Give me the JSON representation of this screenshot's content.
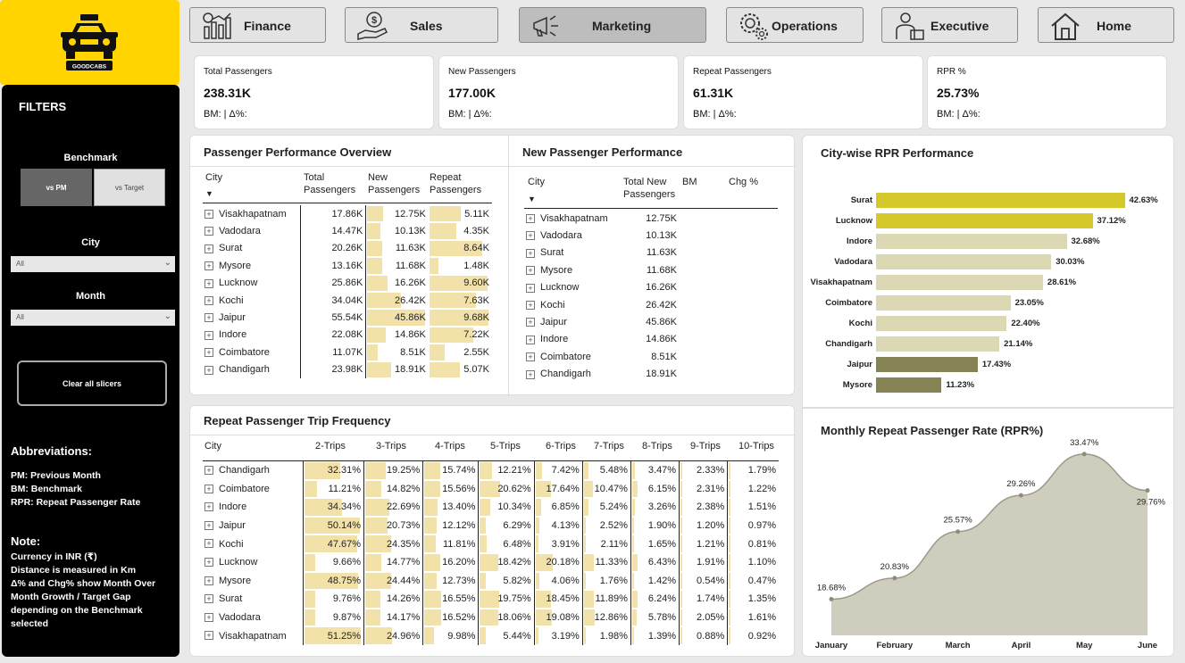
{
  "logo": {
    "text": "GOODCABS"
  },
  "sidebar": {
    "title": "FILTERS",
    "benchmark_label": "Benchmark",
    "bench_options": [
      "vs PM",
      "vs Target"
    ],
    "city_label": "City",
    "city_value": "All",
    "month_label": "Month",
    "month_value": "All",
    "clear_label": "Clear all slicers",
    "abbr_title": "Abbreviations:",
    "abbr": [
      "PM: Previous Month",
      "BM: Benchmark",
      "RPR: Repeat Passenger Rate"
    ],
    "note_title": "Note:",
    "note_lines": [
      "Currency in INR (₹)",
      "Distance is measured in Km",
      "Δ% and Chg% show Month Over",
      "Month Growth / Target Gap",
      "depending on the Benchmark",
      "selected"
    ]
  },
  "nav": [
    {
      "label": "Finance",
      "icon": "finance-chart-icon"
    },
    {
      "label": "Sales",
      "icon": "sales-hand-coin-icon"
    },
    {
      "label": "Marketing",
      "icon": "megaphone-icon"
    },
    {
      "label": "Operations",
      "icon": "gears-icon"
    },
    {
      "label": "Executive",
      "icon": "executive-person-icon"
    },
    {
      "label": "Home",
      "icon": "home-icon"
    }
  ],
  "kpis": [
    {
      "title": "Total Passengers",
      "value": "238.31K",
      "sub": "BM: | Δ%:"
    },
    {
      "title": "New Passengers",
      "value": "177.00K",
      "sub": "BM: | Δ%:"
    },
    {
      "title": "Repeat Passengers",
      "value": "61.31K",
      "sub": "BM: | Δ%:"
    },
    {
      "title": "RPR %",
      "value": "25.73%",
      "sub": "BM: | Δ%:"
    }
  ],
  "overview": {
    "title": "Passenger Performance Overview",
    "headers": [
      "City",
      "Total Passengers",
      "New Passengers",
      "Repeat Passengers"
    ],
    "rows": [
      {
        "city": "Visakhapatnam",
        "total": "17.86K",
        "new": "12.75K",
        "repeat": "5.11K",
        "new_v": 12.75,
        "rep_v": 5.11
      },
      {
        "city": "Vadodara",
        "total": "14.47K",
        "new": "10.13K",
        "repeat": "4.35K",
        "new_v": 10.13,
        "rep_v": 4.35
      },
      {
        "city": "Surat",
        "total": "20.26K",
        "new": "11.63K",
        "repeat": "8.64K",
        "new_v": 11.63,
        "rep_v": 8.64
      },
      {
        "city": "Mysore",
        "total": "13.16K",
        "new": "11.68K",
        "repeat": "1.48K",
        "new_v": 11.68,
        "rep_v": 1.48
      },
      {
        "city": "Lucknow",
        "total": "25.86K",
        "new": "16.26K",
        "repeat": "9.60K",
        "new_v": 16.26,
        "rep_v": 9.6
      },
      {
        "city": "Kochi",
        "total": "34.04K",
        "new": "26.42K",
        "repeat": "7.63K",
        "new_v": 26.42,
        "rep_v": 7.63
      },
      {
        "city": "Jaipur",
        "total": "55.54K",
        "new": "45.86K",
        "repeat": "9.68K",
        "new_v": 45.86,
        "rep_v": 9.68
      },
      {
        "city": "Indore",
        "total": "22.08K",
        "new": "14.86K",
        "repeat": "7.22K",
        "new_v": 14.86,
        "rep_v": 7.22
      },
      {
        "city": "Coimbatore",
        "total": "11.07K",
        "new": "8.51K",
        "repeat": "2.55K",
        "new_v": 8.51,
        "rep_v": 2.55
      },
      {
        "city": "Chandigarh",
        "total": "23.98K",
        "new": "18.91K",
        "repeat": "5.07K",
        "new_v": 18.91,
        "rep_v": 5.07
      }
    ]
  },
  "newperf": {
    "title": "New Passenger Performance",
    "headers": [
      "City",
      "Total New Passengers",
      "BM",
      "Chg %"
    ],
    "rows": [
      {
        "city": "Visakhapatnam",
        "total": "12.75K"
      },
      {
        "city": "Vadodara",
        "total": "10.13K"
      },
      {
        "city": "Surat",
        "total": "11.63K"
      },
      {
        "city": "Mysore",
        "total": "11.68K"
      },
      {
        "city": "Lucknow",
        "total": "16.26K"
      },
      {
        "city": "Kochi",
        "total": "26.42K"
      },
      {
        "city": "Jaipur",
        "total": "45.86K"
      },
      {
        "city": "Indore",
        "total": "14.86K"
      },
      {
        "city": "Coimbatore",
        "total": "8.51K"
      },
      {
        "city": "Chandigarh",
        "total": "18.91K"
      }
    ]
  },
  "trips": {
    "title": "Repeat Passenger Trip Frequency",
    "headers": [
      "City",
      "2-Trips",
      "3-Trips",
      "4-Trips",
      "5-Trips",
      "6-Trips",
      "7-Trips",
      "8-Trips",
      "9-Trips",
      "10-Trips"
    ],
    "rows": [
      {
        "city": "Chandigarh",
        "vals": [
          "32.31%",
          "19.25%",
          "15.74%",
          "12.21%",
          "7.42%",
          "5.48%",
          "3.47%",
          "2.33%",
          "1.79%"
        ]
      },
      {
        "city": "Coimbatore",
        "vals": [
          "11.21%",
          "14.82%",
          "15.56%",
          "20.62%",
          "17.64%",
          "10.47%",
          "6.15%",
          "2.31%",
          "1.22%"
        ]
      },
      {
        "city": "Indore",
        "vals": [
          "34.34%",
          "22.69%",
          "13.40%",
          "10.34%",
          "6.85%",
          "5.24%",
          "3.26%",
          "2.38%",
          "1.51%"
        ]
      },
      {
        "city": "Jaipur",
        "vals": [
          "50.14%",
          "20.73%",
          "12.12%",
          "6.29%",
          "4.13%",
          "2.52%",
          "1.90%",
          "1.20%",
          "0.97%"
        ]
      },
      {
        "city": "Kochi",
        "vals": [
          "47.67%",
          "24.35%",
          "11.81%",
          "6.48%",
          "3.91%",
          "2.11%",
          "1.65%",
          "1.21%",
          "0.81%"
        ]
      },
      {
        "city": "Lucknow",
        "vals": [
          "9.66%",
          "14.77%",
          "16.20%",
          "18.42%",
          "20.18%",
          "11.33%",
          "6.43%",
          "1.91%",
          "1.10%"
        ]
      },
      {
        "city": "Mysore",
        "vals": [
          "48.75%",
          "24.44%",
          "12.73%",
          "5.82%",
          "4.06%",
          "1.76%",
          "1.42%",
          "0.54%",
          "0.47%"
        ]
      },
      {
        "city": "Surat",
        "vals": [
          "9.76%",
          "14.26%",
          "16.55%",
          "19.75%",
          "18.45%",
          "11.89%",
          "6.24%",
          "1.74%",
          "1.35%"
        ]
      },
      {
        "city": "Vadodara",
        "vals": [
          "9.87%",
          "14.17%",
          "16.52%",
          "18.06%",
          "19.08%",
          "12.86%",
          "5.78%",
          "2.05%",
          "1.61%"
        ]
      },
      {
        "city": "Visakhapatnam",
        "vals": [
          "51.25%",
          "24.96%",
          "9.98%",
          "5.44%",
          "3.19%",
          "1.98%",
          "1.39%",
          "0.88%",
          "0.92%"
        ]
      }
    ]
  },
  "chart_data": [
    {
      "type": "bar",
      "title": "City-wise RPR Performance",
      "orientation": "horizontal",
      "categories": [
        "Surat",
        "Lucknow",
        "Indore",
        "Vadodara",
        "Visakhapatnam",
        "Coimbatore",
        "Kochi",
        "Chandigarh",
        "Jaipur",
        "Mysore"
      ],
      "values": [
        42.63,
        37.12,
        32.68,
        30.03,
        28.61,
        23.05,
        22.4,
        21.14,
        17.43,
        11.23
      ],
      "labels": [
        "42.63%",
        "37.12%",
        "32.68%",
        "30.03%",
        "28.61%",
        "23.05%",
        "22.40%",
        "21.14%",
        "17.43%",
        "11.23%"
      ],
      "colors": [
        "#d4c82a",
        "#d4c82a",
        "#dcd8b4",
        "#dcd8b4",
        "#dcd8b4",
        "#dcd8b4",
        "#dcd8b4",
        "#dcd8b4",
        "#858354",
        "#858354"
      ],
      "xlim": [
        0,
        45
      ]
    },
    {
      "type": "area",
      "title": "Monthly Repeat Passenger Rate (RPR%)",
      "categories": [
        "January",
        "February",
        "March",
        "April",
        "May",
        "June"
      ],
      "values": [
        18.68,
        20.83,
        25.57,
        29.26,
        33.47,
        29.76
      ],
      "labels": [
        "18.68%",
        "20.83%",
        "25.57%",
        "29.26%",
        "33.47%",
        "29.76%"
      ],
      "color": "#cfcdbe",
      "line_color": "#9c9a86"
    }
  ]
}
